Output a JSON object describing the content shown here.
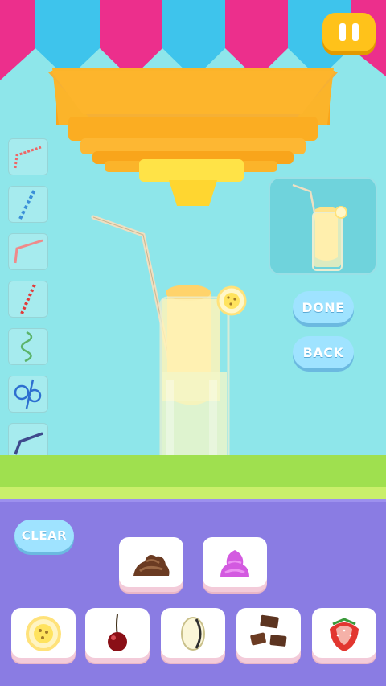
{
  "hud": {
    "pause_icon": "pause-icon",
    "accent": "#ffc21a"
  },
  "straws": [
    {
      "name": "red-striped-bent-straw"
    },
    {
      "name": "blue-striped-straw"
    },
    {
      "name": "pink-bent-straw"
    },
    {
      "name": "red-striped-straight-straw"
    },
    {
      "name": "green-curly-straw"
    },
    {
      "name": "blue-loop-straw"
    },
    {
      "name": "navy-bent-straw"
    }
  ],
  "preview": {
    "label": ""
  },
  "buttons": {
    "done": "DONE",
    "back": "BACK",
    "clear": "CLEAR"
  },
  "toppings": [
    {
      "name": "chocolate-cream"
    },
    {
      "name": "pink-cream"
    },
    {
      "name": "banana-slice"
    },
    {
      "name": "cherry"
    },
    {
      "name": "apple-slice"
    },
    {
      "name": "chocolate-pieces"
    },
    {
      "name": "strawberry"
    }
  ],
  "colors": {
    "sky": "#8ee6ea",
    "tray": "#8a7ce3",
    "ground": "#9fe04f",
    "awning_pink": "#ec2f8c",
    "awning_blue": "#3ec4ec",
    "juicer": "#f8a81c"
  }
}
